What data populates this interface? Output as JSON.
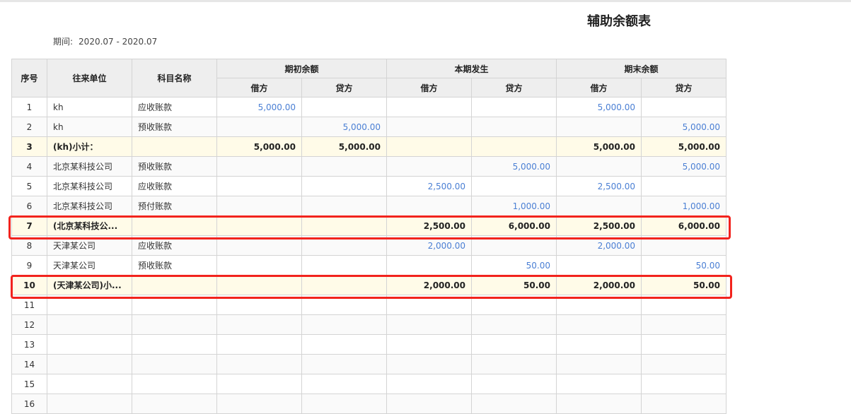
{
  "title": "辅助余额表",
  "period": {
    "label": "期间:",
    "value": "2020.07 - 2020.07"
  },
  "headers": {
    "seq": "序号",
    "unit": "往来单位",
    "subject": "科目名称",
    "opening": "期初余额",
    "current": "本期发生",
    "closing": "期末余额",
    "debit": "借方",
    "credit": "贷方"
  },
  "rows": [
    {
      "seq": "1",
      "unit": "kh",
      "subject": "应收账款",
      "od": "5,000.00",
      "oc": "",
      "cd": "",
      "cc": "",
      "ed": "5,000.00",
      "ec": "",
      "type": "normal"
    },
    {
      "seq": "2",
      "unit": "kh",
      "subject": "预收账款",
      "od": "",
      "oc": "5,000.00",
      "cd": "",
      "cc": "",
      "ed": "",
      "ec": "5,000.00",
      "type": "normal"
    },
    {
      "seq": "3",
      "unit": "(kh)小计：",
      "subject": "",
      "od": "5,000.00",
      "oc": "5,000.00",
      "cd": "",
      "cc": "",
      "ed": "5,000.00",
      "ec": "5,000.00",
      "type": "subtotal"
    },
    {
      "seq": "4",
      "unit": "北京某科技公司",
      "subject": "预收账款",
      "od": "",
      "oc": "",
      "cd": "",
      "cc": "5,000.00",
      "ed": "",
      "ec": "5,000.00",
      "type": "normal"
    },
    {
      "seq": "5",
      "unit": "北京某科技公司",
      "subject": "应收账款",
      "od": "",
      "oc": "",
      "cd": "2,500.00",
      "cc": "",
      "ed": "2,500.00",
      "ec": "",
      "type": "normal"
    },
    {
      "seq": "6",
      "unit": "北京某科技公司",
      "subject": "预付账款",
      "od": "",
      "oc": "",
      "cd": "",
      "cc": "1,000.00",
      "ed": "",
      "ec": "1,000.00",
      "type": "normal"
    },
    {
      "seq": "7",
      "unit": "(北京某科技公...",
      "subject": "",
      "od": "",
      "oc": "",
      "cd": "2,500.00",
      "cc": "6,000.00",
      "ed": "2,500.00",
      "ec": "6,000.00",
      "type": "subtotal"
    },
    {
      "seq": "8",
      "unit": "天津某公司",
      "subject": "应收账款",
      "od": "",
      "oc": "",
      "cd": "2,000.00",
      "cc": "",
      "ed": "2,000.00",
      "ec": "",
      "type": "normal"
    },
    {
      "seq": "9",
      "unit": "天津某公司",
      "subject": "预收账款",
      "od": "",
      "oc": "",
      "cd": "",
      "cc": "50.00",
      "ed": "",
      "ec": "50.00",
      "type": "normal"
    },
    {
      "seq": "10",
      "unit": "(天津某公司)小...",
      "subject": "",
      "od": "",
      "oc": "",
      "cd": "2,000.00",
      "cc": "50.00",
      "ed": "2,000.00",
      "ec": "50.00",
      "type": "subtotal"
    },
    {
      "seq": "11",
      "unit": "",
      "subject": "",
      "od": "",
      "oc": "",
      "cd": "",
      "cc": "",
      "ed": "",
      "ec": "",
      "type": "empty"
    },
    {
      "seq": "12",
      "unit": "",
      "subject": "",
      "od": "",
      "oc": "",
      "cd": "",
      "cc": "",
      "ed": "",
      "ec": "",
      "type": "empty"
    },
    {
      "seq": "13",
      "unit": "",
      "subject": "",
      "od": "",
      "oc": "",
      "cd": "",
      "cc": "",
      "ed": "",
      "ec": "",
      "type": "empty"
    },
    {
      "seq": "14",
      "unit": "",
      "subject": "",
      "od": "",
      "oc": "",
      "cd": "",
      "cc": "",
      "ed": "",
      "ec": "",
      "type": "empty"
    },
    {
      "seq": "15",
      "unit": "",
      "subject": "",
      "od": "",
      "oc": "",
      "cd": "",
      "cc": "",
      "ed": "",
      "ec": "",
      "type": "empty"
    },
    {
      "seq": "16",
      "unit": "",
      "subject": "",
      "od": "",
      "oc": "",
      "cd": "",
      "cc": "",
      "ed": "",
      "ec": "",
      "type": "empty"
    }
  ],
  "colors": {
    "highlight": "#f2231d",
    "number": "#4a7fd4",
    "subtotal_bg": "#fffbe8",
    "header_bg": "#eeeeee"
  }
}
